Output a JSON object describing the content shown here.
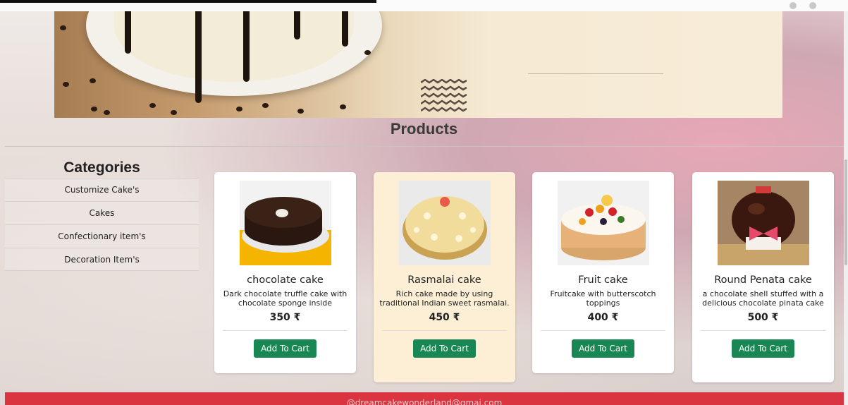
{
  "main": {
    "products_title": "Products"
  },
  "categories": {
    "title": "Categories",
    "items": [
      "Customize Cake's",
      "Cakes",
      "Confectionary item's",
      "Decoration Item's"
    ]
  },
  "products": [
    {
      "name": "chocolate cake",
      "desc": "Dark chocolate truffle cake with chocolate sponge inside",
      "price": "350 ₹",
      "button": "Add To Cart"
    },
    {
      "name": "Rasmalai cake",
      "desc": "Rich cake made by using traditional Indian sweet rasmalai.",
      "price": "450 ₹",
      "button": "Add To Cart"
    },
    {
      "name": "Fruit cake",
      "desc": "Fruitcake with butterscotch toppings",
      "price": "400 ₹",
      "button": "Add To Cart"
    },
    {
      "name": "Round Penata cake",
      "desc": "a chocolate shell stuffed with a delicious chocolate pinata cake",
      "price": "500 ₹",
      "button": "Add To Cart"
    }
  ],
  "footer": {
    "email": "@dreamcakewonderland@gmai.com"
  },
  "colors": {
    "button": "#198754",
    "footer": "#d9343f",
    "highlight_card": "#fcefd6"
  }
}
